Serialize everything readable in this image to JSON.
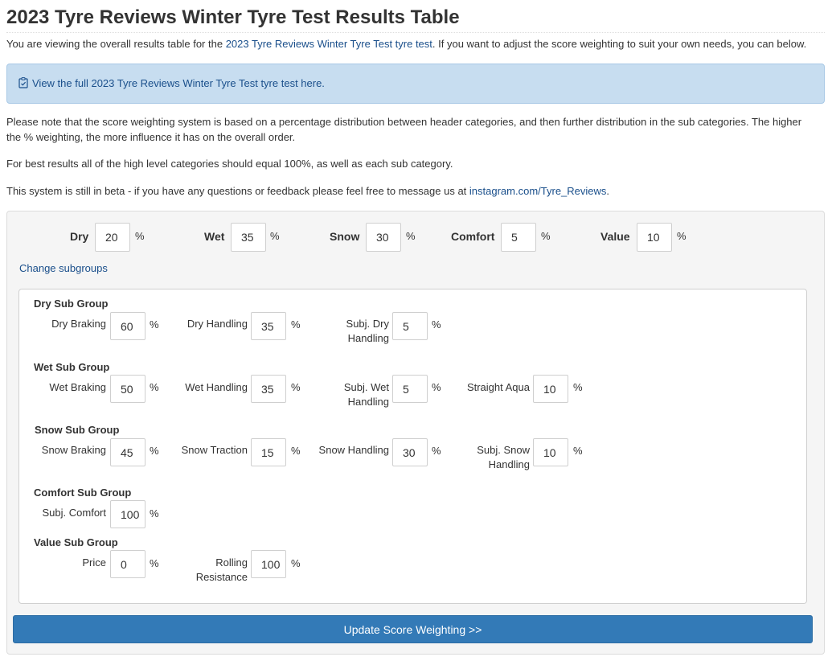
{
  "title": "2023 Tyre Reviews Winter Tyre Test Results Table",
  "intro": {
    "prefix": "You are viewing the overall results table for the ",
    "link": "2023 Tyre Reviews Winter Tyre Test tyre test",
    "suffix": ". If you want to adjust the score weighting to suit your own needs, you can below."
  },
  "alert": {
    "icon": "clipboard-check-icon",
    "text": "View the full 2023 Tyre Reviews Winter Tyre Test tyre test here."
  },
  "notes": {
    "p1": "Please note that the score weighting system is based on a percentage distribution between header categories, and then further distribution in the sub categories. The higher the % weighting, the more influence it has on the overall order.",
    "p2": "For best results all of the high level categories should equal 100%, as well as each sub category.",
    "p3_prefix": "This system is still in beta - if you have any questions or feedback please feel free to message us at ",
    "p3_link": "instagram.com/Tyre_Reviews",
    "p3_suffix": "."
  },
  "percent_sign": "%",
  "header": {
    "dry": {
      "label": "Dry",
      "value": "20"
    },
    "wet": {
      "label": "Wet",
      "value": "35"
    },
    "snow": {
      "label": "Snow",
      "value": "30"
    },
    "comfort": {
      "label": "Comfort",
      "value": "5"
    },
    "value": {
      "label": "Value",
      "value": "10"
    }
  },
  "change_subgroups": "Change subgroups",
  "dry_group": {
    "title": "Dry Sub Group",
    "braking": {
      "label": "Dry Braking",
      "value": "60"
    },
    "handling": {
      "label": "Dry Handling",
      "value": "35"
    },
    "subj": {
      "label1": "Subj. Dry",
      "label2": "Handling",
      "value": "5"
    }
  },
  "wet_group": {
    "title": "Wet Sub Group",
    "braking": {
      "label": "Wet Braking",
      "value": "50"
    },
    "handling": {
      "label": "Wet Handling",
      "value": "35"
    },
    "subj": {
      "label1": "Subj. Wet",
      "label2": "Handling",
      "value": "5"
    },
    "aqua": {
      "label": "Straight Aqua",
      "value": "10"
    }
  },
  "snow_group": {
    "title": "Snow Sub Group",
    "braking": {
      "label": "Snow Braking",
      "value": "45"
    },
    "traction": {
      "label": "Snow Traction",
      "value": "15"
    },
    "handling": {
      "label": "Snow Handling",
      "value": "30"
    },
    "subj": {
      "label1": "Subj. Snow",
      "label2": "Handling",
      "value": "10"
    }
  },
  "comfort_group": {
    "title": "Comfort Sub Group",
    "subj": {
      "label": "Subj. Comfort",
      "value": "100"
    }
  },
  "value_group": {
    "title": "Value Sub Group",
    "price": {
      "label": "Price",
      "value": "0"
    },
    "rolling": {
      "label1": "Rolling",
      "label2": "Resistance",
      "value": "100"
    }
  },
  "update_button": "Update Score Weighting >>"
}
